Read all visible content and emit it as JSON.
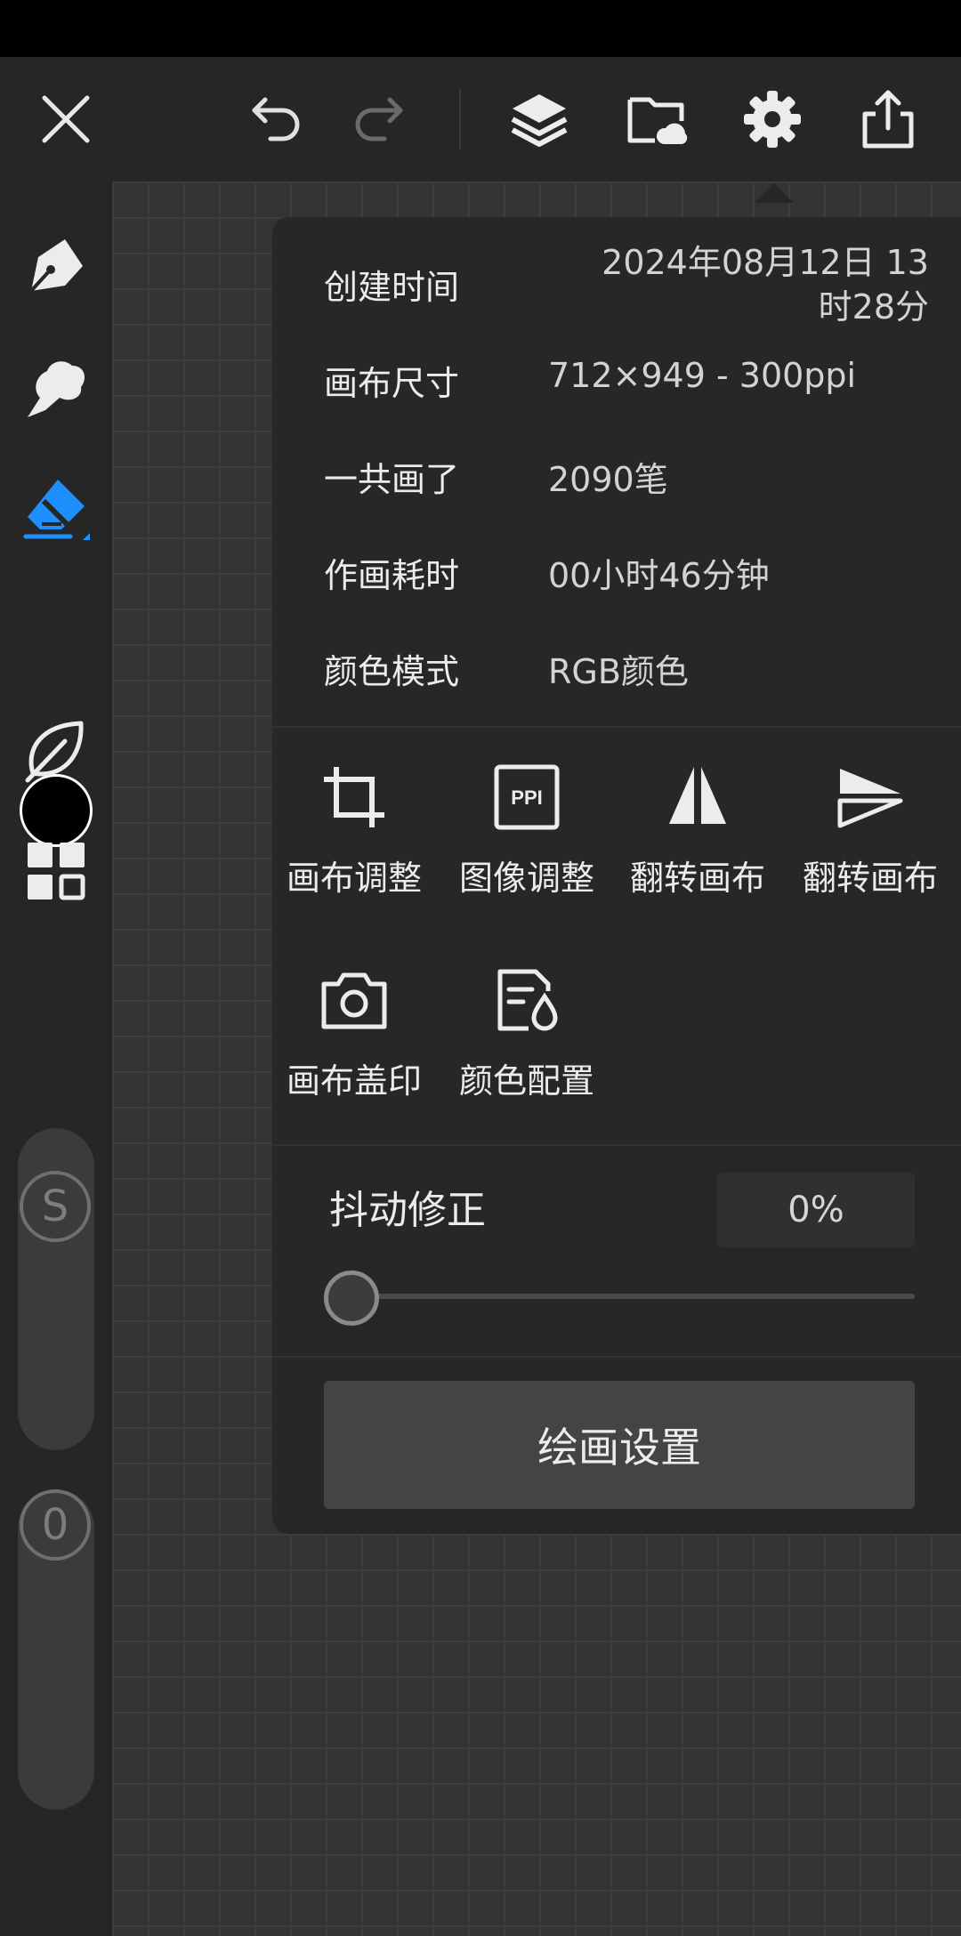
{
  "info": [
    {
      "key": "创建时间",
      "value_line1": "2024年08月12日 13",
      "value_line2": "时28分"
    },
    {
      "key": "画布尺寸",
      "value": "712×949 - 300ppi"
    },
    {
      "key": "一共画了",
      "value": "2090笔"
    },
    {
      "key": "作画耗时",
      "value": "00小时46分钟"
    },
    {
      "key": "颜色模式",
      "value": "RGB颜色"
    }
  ],
  "tools": [
    {
      "label": "画布调整",
      "icon": "crop-icon"
    },
    {
      "label": "图像调整",
      "icon": "ppi-icon"
    },
    {
      "label": "翻转画布",
      "icon": "flip-horizontal-icon"
    },
    {
      "label": "翻转画布",
      "icon": "flip-vertical-icon"
    },
    {
      "label": "画布盖印",
      "icon": "camera-icon"
    },
    {
      "label": "颜色配置",
      "icon": "color-profile-icon"
    }
  ],
  "stabilizer": {
    "label": "抖动修正",
    "value_text": "0%",
    "value": 0
  },
  "paint_settings_label": "绘画设置",
  "sidebar": {
    "brush_size_letter": "S",
    "opacity_value": "0",
    "current_color": "#000000",
    "active_tool_color": "#1e8fff"
  }
}
